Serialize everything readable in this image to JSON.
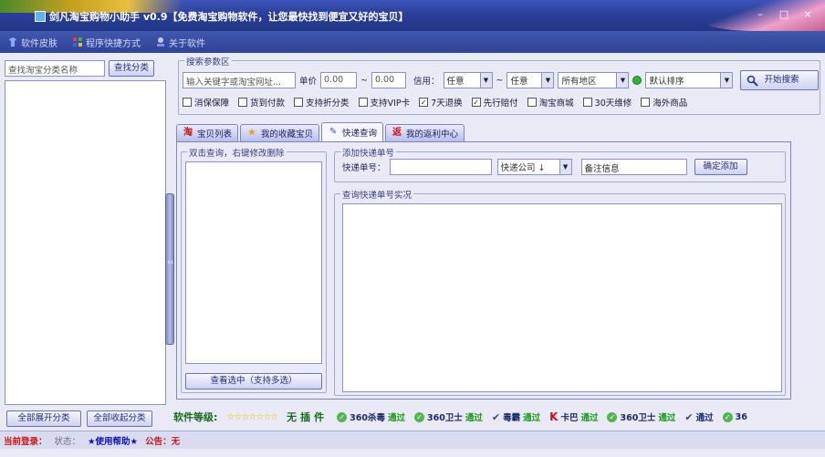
{
  "window": {
    "title": "剑凡淘宝购物小助手 v0.9【免费淘宝购物软件，让您最快找到便宜又好的宝贝】",
    "minimize": "–",
    "maximize": "□",
    "close": "×"
  },
  "menu": [
    {
      "label": "软件皮肤",
      "icon": "skin-icon"
    },
    {
      "label": "程序快捷方式",
      "icon": "shortcut-icon"
    },
    {
      "label": "关于软件",
      "icon": "about-icon"
    }
  ],
  "left": {
    "search_placeholder": "查找淘宝分类名称",
    "search_button": "查找分类",
    "expand_button": "全部展开分类",
    "collapse_button": "全部收起分类"
  },
  "search": {
    "group_title": "搜索参数区",
    "keyword_placeholder": "输入关键字或淘宝网址...",
    "price_label": "单价",
    "price_min": "0.00",
    "price_sep": "~",
    "price_max": "0.00",
    "credit_label": "信用：",
    "credit_min": "任意",
    "credit_sep": "~",
    "credit_max": "任意",
    "region": "所有地区",
    "sort": "默认排序",
    "start_button": "开始搜索",
    "checks": [
      {
        "label": "消保保障",
        "checked": false
      },
      {
        "label": "货到付款",
        "checked": false
      },
      {
        "label": "支持折分类",
        "checked": false
      },
      {
        "label": "支持VIP卡",
        "checked": false
      },
      {
        "label": "7天退换",
        "checked": true
      },
      {
        "label": "先行赔付",
        "checked": true
      },
      {
        "label": "淘宝商城",
        "checked": false
      },
      {
        "label": "30天维修",
        "checked": false
      },
      {
        "label": "海外商品",
        "checked": false
      }
    ]
  },
  "tabs": [
    {
      "label": "宝贝列表",
      "icon": "淘"
    },
    {
      "label": "我的收藏宝贝",
      "icon": "★"
    },
    {
      "label": "快递查询",
      "icon": "✎"
    },
    {
      "label": "我的返利中心",
      "icon": "返"
    }
  ],
  "express": {
    "history_title": "双击查询，右键修改删除",
    "history_button": "查看选中（支持多选）",
    "add_title": "添加快递单号",
    "number_label": "快递单号：",
    "company": "快递公司 ↓",
    "note": "备注信息",
    "confirm_button": "确定添加",
    "result_title": "查询快递单号实况"
  },
  "strip": {
    "level_label": "软件等级:",
    "stars": "☆☆☆☆☆☆☆",
    "no_plugin": "无插件",
    "badges": [
      {
        "text": "360杀毒",
        "pass": "通过",
        "type": "round"
      },
      {
        "text": "360卫士",
        "pass": "通过",
        "type": "round"
      },
      {
        "text": "毒霸",
        "pass": "通过",
        "type": "v"
      },
      {
        "text": "卡巴",
        "pass": "通过",
        "type": "k"
      },
      {
        "text": "360卫士",
        "pass": "通过",
        "type": "round"
      },
      {
        "text": "通过",
        "pass": "",
        "type": "v"
      },
      {
        "text": "36",
        "pass": "",
        "type": "round"
      }
    ]
  },
  "status": {
    "login": "当前登录：",
    "state": "状态：",
    "help": "★使用帮助★",
    "notice_label": "公告：",
    "notice": "无"
  }
}
